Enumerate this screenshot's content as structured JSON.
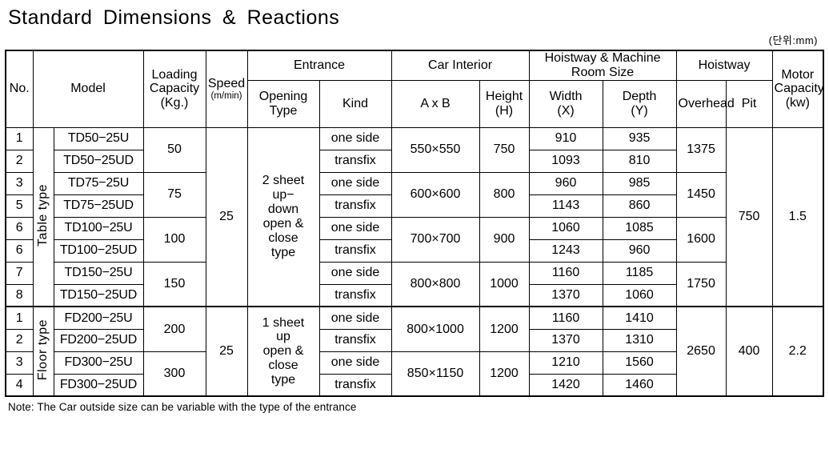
{
  "title": "Standard  Dimensions  &  Reactions",
  "unit_note": "(단위:mm)",
  "footnote": "Note: The Car outside size can be variable with the type of the entrance",
  "headers": {
    "no": "No.",
    "model": "Model",
    "loading_capacity": "Loading\nCapacity\n(Kg.)",
    "loading_capacity_l1": "Loading",
    "loading_capacity_l2": "Capacity",
    "loading_capacity_l3": "(Kg.)",
    "speed_l1": "Speed",
    "speed_l2": "(m/min)",
    "entrance": "Entrance",
    "opening_type_l1": "Opening",
    "opening_type_l2": "Type",
    "kind": "Kind",
    "car_interior": "Car Interior",
    "axb": "A x B",
    "height_l1": "Height",
    "height_l2": "(H)",
    "hoistway_machine_room": "Hoistway & Machine Room Size",
    "width_l1": "Width",
    "width_l2": "(X)",
    "depth_l1": "Depth",
    "depth_l2": "(Y)",
    "hoistway": "Hoistway",
    "overhead": "Overhead",
    "pit": "Pit",
    "motor_capacity_l1": "Motor",
    "motor_capacity_l2": "Capacity",
    "motor_capacity_l3": "(kw)"
  },
  "groups": [
    {
      "type_label": "Table type",
      "speed": "25",
      "opening_type": "2 sheet\nup−\ndown\nopen &\nclose\ntype",
      "opening_type_lines": [
        "2 sheet",
        "up−",
        "down",
        "open &",
        "close",
        "type"
      ],
      "pit": "750",
      "motor_capacity": "1.5",
      "pairs": [
        {
          "loading_capacity": "50",
          "axb": "550×550",
          "height": "750",
          "overhead": "1375",
          "rows": [
            {
              "no": "1",
              "model": "TD50−25U",
              "kind": "one side",
              "width": "910",
              "depth": "935"
            },
            {
              "no": "2",
              "model": "TD50−25UD",
              "kind": "transfix",
              "width": "1093",
              "depth": "810"
            }
          ]
        },
        {
          "loading_capacity": "75",
          "axb": "600×600",
          "height": "800",
          "overhead": "1450",
          "rows": [
            {
              "no": "3",
              "model": "TD75−25U",
              "kind": "one side",
              "width": "960",
              "depth": "985"
            },
            {
              "no": "5",
              "model": "TD75−25UD",
              "kind": "transfix",
              "width": "1143",
              "depth": "860"
            }
          ]
        },
        {
          "loading_capacity": "100",
          "axb": "700×700",
          "height": "900",
          "overhead": "1600",
          "rows": [
            {
              "no": "6",
              "model": "TD100−25U",
              "kind": "one side",
              "width": "1060",
              "depth": "1085"
            },
            {
              "no": "6",
              "model": "TD100−25UD",
              "kind": "transfix",
              "width": "1243",
              "depth": "960"
            }
          ]
        },
        {
          "loading_capacity": "150",
          "axb": "800×800",
          "height": "1000",
          "overhead": "1750",
          "rows": [
            {
              "no": "7",
              "model": "TD150−25U",
              "kind": "one side",
              "width": "1160",
              "depth": "1185"
            },
            {
              "no": "8",
              "model": "TD150−25UD",
              "kind": "transfix",
              "width": "1370",
              "depth": "1060"
            }
          ]
        }
      ]
    },
    {
      "type_label": "Floor type",
      "speed": "25",
      "opening_type": "1 sheet\nup\nopen &\nclose\ntype",
      "opening_type_lines": [
        "1 sheet",
        "up",
        "open &",
        "close",
        "type"
      ],
      "pit": "400",
      "motor_capacity": "2.2",
      "overhead": "2650",
      "pairs": [
        {
          "loading_capacity": "200",
          "axb": "800×1000",
          "height": "1200",
          "rows": [
            {
              "no": "1",
              "model": "FD200−25U",
              "kind": "one side",
              "width": "1160",
              "depth": "1410"
            },
            {
              "no": "2",
              "model": "FD200−25UD",
              "kind": "transfix",
              "width": "1370",
              "depth": "1310"
            }
          ]
        },
        {
          "loading_capacity": "300",
          "axb": "850×1150",
          "height": "1200",
          "rows": [
            {
              "no": "3",
              "model": "FD300−25U",
              "kind": "one side",
              "width": "1210",
              "depth": "1560"
            },
            {
              "no": "4",
              "model": "FD300−25UD",
              "kind": "transfix",
              "width": "1420",
              "depth": "1460"
            }
          ]
        }
      ]
    }
  ]
}
